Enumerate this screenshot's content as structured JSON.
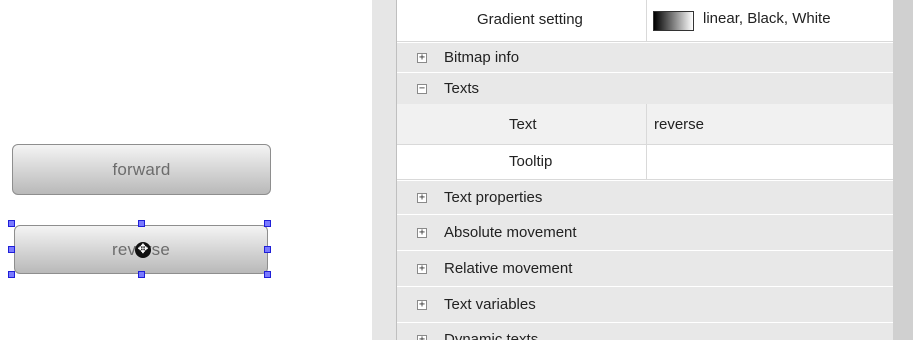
{
  "canvas": {
    "forward_button": {
      "label": "forward"
    },
    "reverse_button": {
      "label": "reverse"
    }
  },
  "property_grid": {
    "rows": [
      {
        "kind": "property",
        "name": "Gradient setting",
        "value": "linear, Black, White",
        "swatch": "gradient black-white"
      },
      {
        "kind": "group",
        "label": "Bitmap info",
        "expanded": false,
        "expander": "+"
      },
      {
        "kind": "group",
        "label": "Texts",
        "expanded": true,
        "expander": "−"
      },
      {
        "kind": "property",
        "name": "Text",
        "value": "reverse"
      },
      {
        "kind": "property",
        "name": "Tooltip",
        "value": ""
      },
      {
        "kind": "group",
        "label": "Text properties",
        "expanded": false,
        "expander": "+"
      },
      {
        "kind": "group",
        "label": "Absolute movement",
        "expanded": false,
        "expander": "+"
      },
      {
        "kind": "group",
        "label": "Relative movement",
        "expanded": false,
        "expander": "+"
      },
      {
        "kind": "group",
        "label": "Text variables",
        "expanded": false,
        "expander": "+"
      },
      {
        "kind": "group",
        "label": "Dynamic texts",
        "expanded": false,
        "expander": "+"
      }
    ]
  },
  "colors": {
    "selection_handle": "#7a7aff",
    "group_row_bg": "#e8e8e8",
    "button_text": "#6c6c6c"
  }
}
